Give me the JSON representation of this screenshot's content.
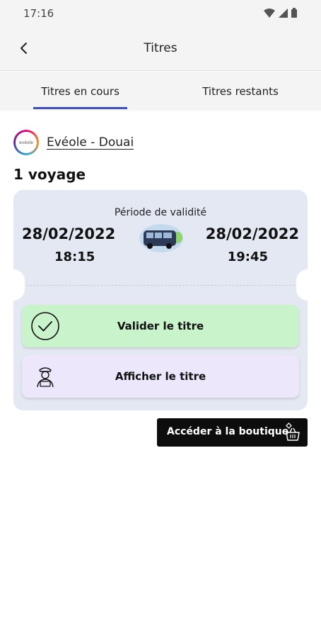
{
  "status_bar": {
    "time": "17:16"
  },
  "header": {
    "title": "Titres"
  },
  "tabs": [
    {
      "label": "Titres en cours",
      "active": true
    },
    {
      "label": "Titres restants",
      "active": false
    }
  ],
  "operator": {
    "logo_text": "evéole",
    "name": "Evéole - Douai"
  },
  "ticket": {
    "title": "1 voyage",
    "validity_label": "Période de validité",
    "start_date": "28/02/2022",
    "start_time": "18:15",
    "end_date": "28/02/2022",
    "end_time": "19:45",
    "validate_label": "Valider le titre",
    "show_label": "Afficher le titre"
  },
  "shop_button": {
    "label": "Accéder à la boutique"
  },
  "colors": {
    "accent": "#3d4fc1",
    "card_bg": "#e3e8f2",
    "validate_bg": "#c9f3cb",
    "show_bg": "#ece7fa",
    "shop_bg": "#0d0d0d"
  }
}
